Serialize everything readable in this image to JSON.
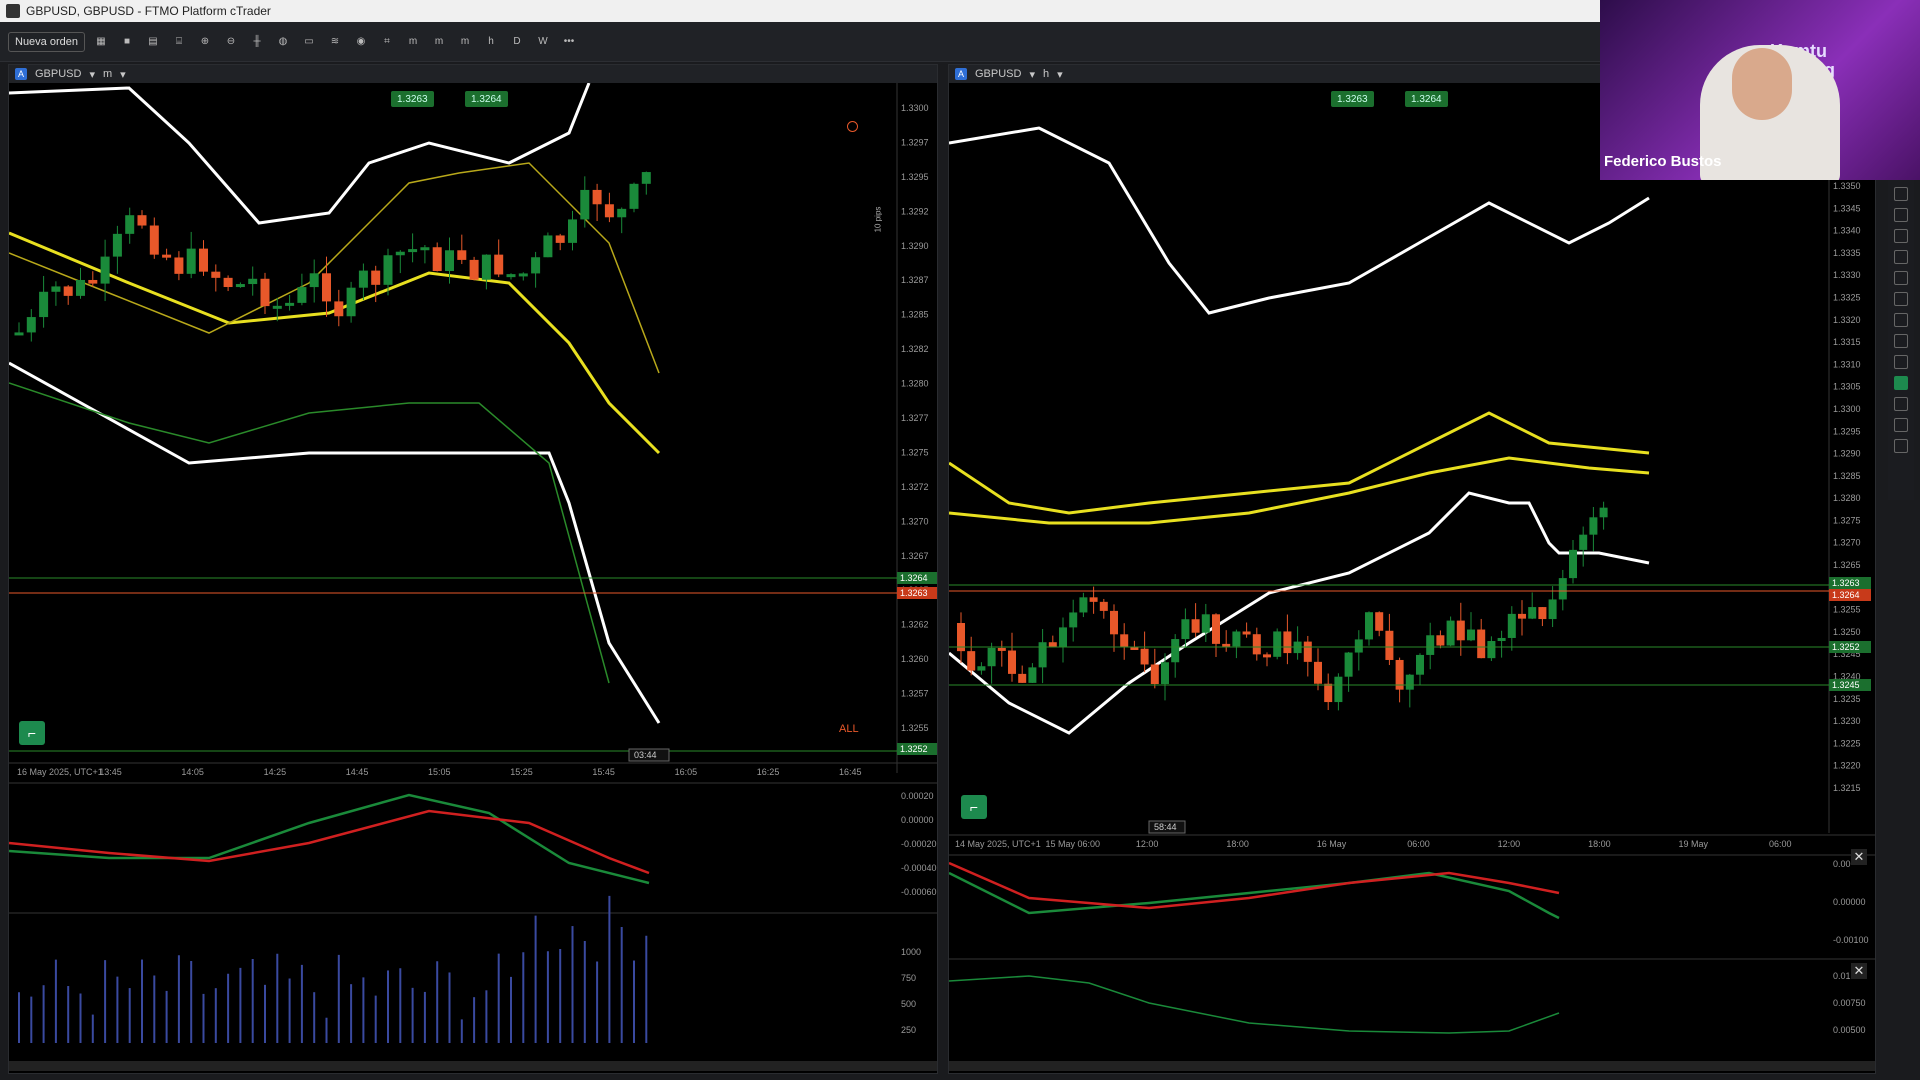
{
  "window": {
    "title": "GBPUSD, GBPUSD - FTMO Platform cTrader"
  },
  "toolbar": {
    "new_order": "Nueva orden",
    "tf_m": "m",
    "tf_h": "h",
    "tf_d": "D",
    "tf_w": "W",
    "more": "•••"
  },
  "left": {
    "symbol": "GBPUSD",
    "timeframe": "m",
    "bid_tag": "1.3263",
    "ask_tag": "1.3264",
    "pips_label": "10 pips",
    "ruler_icon": "circle-icon",
    "all_label": "ALL",
    "time_cursor": "03:44",
    "price_axis": [
      "1.3300",
      "1.3297",
      "1.3295",
      "1.3292",
      "1.3290",
      "1.3287",
      "1.3285",
      "1.3282",
      "1.3280",
      "1.3277",
      "1.3275",
      "1.3272",
      "1.3270",
      "1.3267",
      "1.3265",
      "1.3262",
      "1.3260",
      "1.3257",
      "1.3255"
    ],
    "price_boxes": [
      "1.3264",
      "1.3263",
      "1.3252"
    ],
    "time_axis": [
      "16 May 2025, UTC+1",
      "13:45",
      "14:05",
      "14:25",
      "14:45",
      "15:05",
      "15:25",
      "15:45",
      "16:05",
      "16:25",
      "16:45"
    ],
    "macd_axis": [
      "0.00020",
      "0.00000",
      "-0.00020",
      "-0.00040",
      "-0.00060"
    ],
    "volume_axis": [
      "1000",
      "750",
      "500",
      "250"
    ]
  },
  "right": {
    "symbol": "GBPUSD",
    "timeframe": "h",
    "bid_tag": "1.3263",
    "ask_tag": "1.3264",
    "time_cursor": "58:44",
    "price_axis": [
      "1.3350",
      "1.3345",
      "1.3340",
      "1.3335",
      "1.3330",
      "1.3325",
      "1.3320",
      "1.3315",
      "1.3310",
      "1.3305",
      "1.3300",
      "1.3295",
      "1.3290",
      "1.3285",
      "1.3280",
      "1.3275",
      "1.3270",
      "1.3265",
      "1.3260",
      "1.3255",
      "1.3250",
      "1.3245",
      "1.3240",
      "1.3235",
      "1.3230",
      "1.3225",
      "1.3220",
      "1.3215"
    ],
    "price_boxes": [
      "1.3263",
      "1.3264",
      "1.3252",
      "1.3245"
    ],
    "time_axis": [
      "14 May 2025, UTC+1",
      "15 May 06:00",
      "12:00",
      "18:00",
      "16 May",
      "06:00",
      "12:00",
      "18:00",
      "19 May",
      "06:00"
    ],
    "macd_axis": [
      "0.00",
      "0.00000",
      "-0.00100"
    ],
    "ind2_axis": [
      "0.01",
      "0.00750",
      "0.00500"
    ]
  },
  "webcam": {
    "brand_line1": "Komtu",
    "brand_line2": "Trading",
    "presenter": "Federico Bustos"
  },
  "colors": {
    "bull": "#1a8a3a",
    "bear": "#e8582a",
    "band": "#ffffff",
    "ema": "#e8e020",
    "bg": "#000000"
  }
}
